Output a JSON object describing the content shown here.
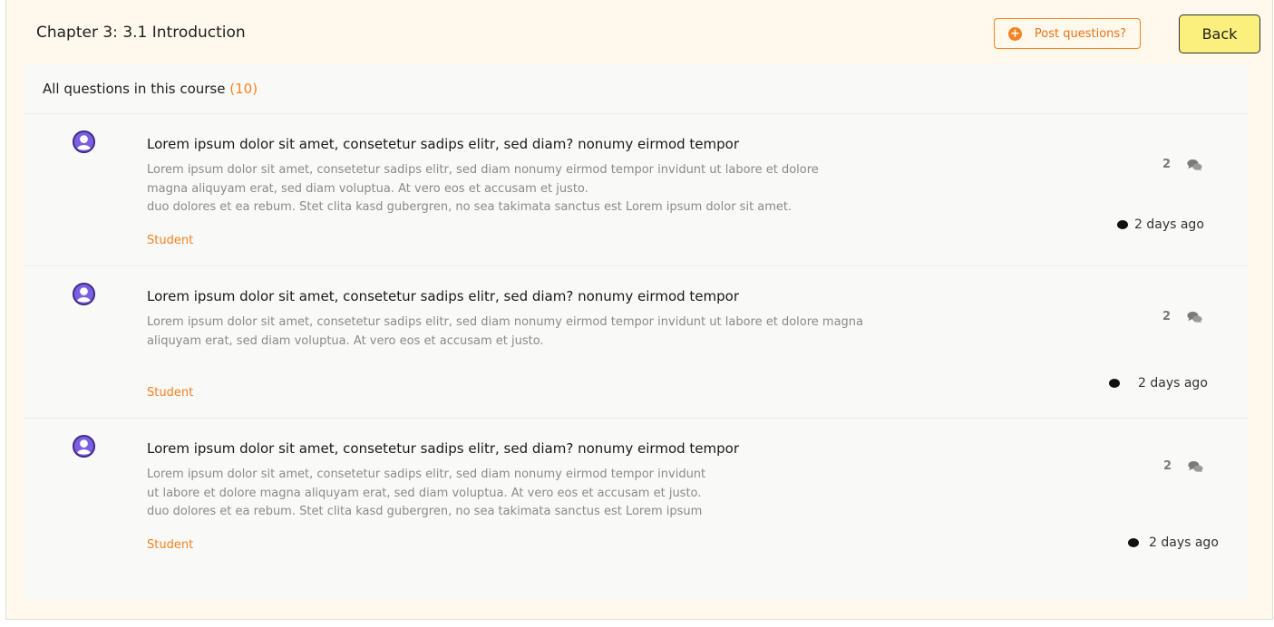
{
  "header": {
    "title": "Chapter 3: 3.1 Introduction",
    "post_label": "Post questions?",
    "back_label": "Back"
  },
  "panel": {
    "heading": "All questions in this course ",
    "count": "(10)"
  },
  "colors": {
    "accent": "#f5821f",
    "back_button": "#fbf07e",
    "avatar": "#7b5fe0",
    "page_bg": "#fff8ec"
  },
  "questions": [
    {
      "title": "Lorem ipsum dolor sit amet, consetetur sadips elitr, sed diam? nonumy eirmod tempor",
      "body_lines": [
        "Lorem ipsum dolor sit amet, consetetur sadips elitr, sed diam nonumy eirmod tempor invidunt ut labore et dolore",
        "magna aliquyam erat, sed diam voluptua. At vero eos et accusam et justo.",
        "duo dolores et ea rebum. Stet clita kasd gubergren, no sea takimata sanctus est Lorem ipsum dolor sit amet."
      ],
      "role": "Student",
      "replies": "2",
      "time": "2 days ago",
      "icons": {
        "avatar": "user-avatar-icon",
        "replies": "chat-bubbles-icon"
      }
    },
    {
      "title": "Lorem ipsum dolor sit amet, consetetur sadips elitr, sed diam? nonumy eirmod tempor",
      "body_lines": [
        "Lorem ipsum dolor sit amet, consetetur sadips elitr, sed diam nonumy eirmod tempor invidunt ut labore et dolore magna",
        "aliquyam erat, sed diam voluptua. At vero eos et accusam et justo.",
        ""
      ],
      "role": "Student",
      "replies": "2",
      "time": "2 days ago",
      "icons": {
        "avatar": "user-avatar-icon",
        "replies": "chat-bubbles-icon"
      }
    },
    {
      "title": "Lorem ipsum dolor sit amet, consetetur sadips elitr, sed diam? nonumy eirmod tempor",
      "body_lines": [
        "Lorem ipsum dolor sit amet, consetetur sadips elitr, sed diam nonumy eirmod tempor invidunt",
        "ut labore et dolore magna aliquyam erat, sed diam voluptua. At vero eos et accusam et justo.",
        "duo dolores et ea rebum. Stet clita kasd gubergren, no sea takimata sanctus est Lorem ipsum"
      ],
      "role": "Student",
      "replies": "2",
      "time": "2 days ago",
      "icons": {
        "avatar": "user-avatar-icon",
        "replies": "chat-bubbles-icon"
      }
    }
  ]
}
